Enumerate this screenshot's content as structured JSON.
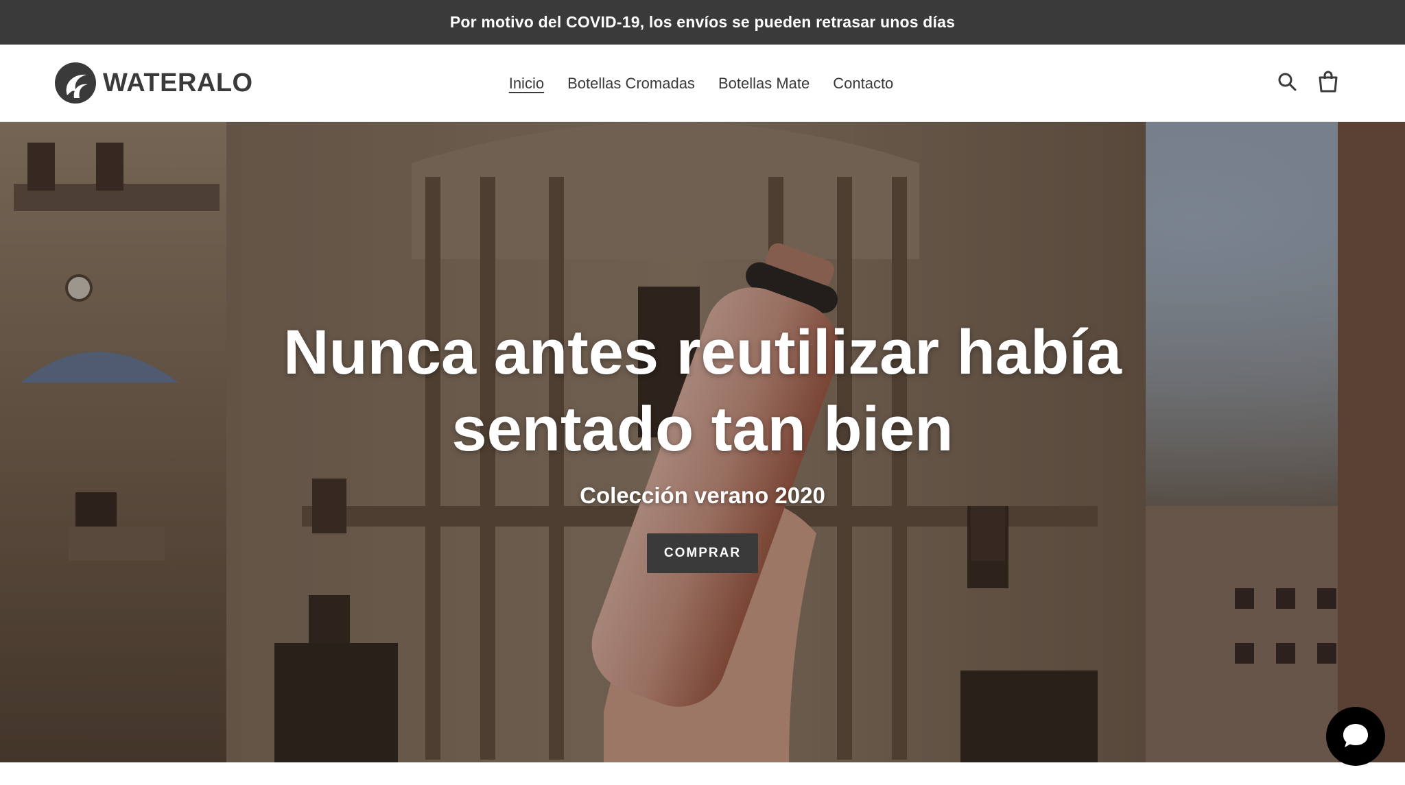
{
  "announcement": {
    "text": "Por motivo del COVID-19, los envíos se pueden retrasar unos días"
  },
  "header": {
    "logo_text": "WATERALO",
    "nav": [
      {
        "label": "Inicio",
        "active": true
      },
      {
        "label": "Botellas Cromadas",
        "active": false
      },
      {
        "label": "Botellas Mate",
        "active": false
      },
      {
        "label": "Contacto",
        "active": false
      }
    ],
    "icons": [
      "search-icon",
      "cart-icon"
    ]
  },
  "hero": {
    "title": "Nunca antes reutilizar había sentado tan bien",
    "subtitle": "Colección verano 2020",
    "cta_label": "COMPRAR"
  },
  "chat": {
    "icon": "chat-bubble-icon"
  },
  "colors": {
    "announce_bg": "#3a3a3a",
    "text_dark": "#3a3a3a",
    "cta_bg": "#3a3a3a",
    "chat_bg": "#000000"
  }
}
